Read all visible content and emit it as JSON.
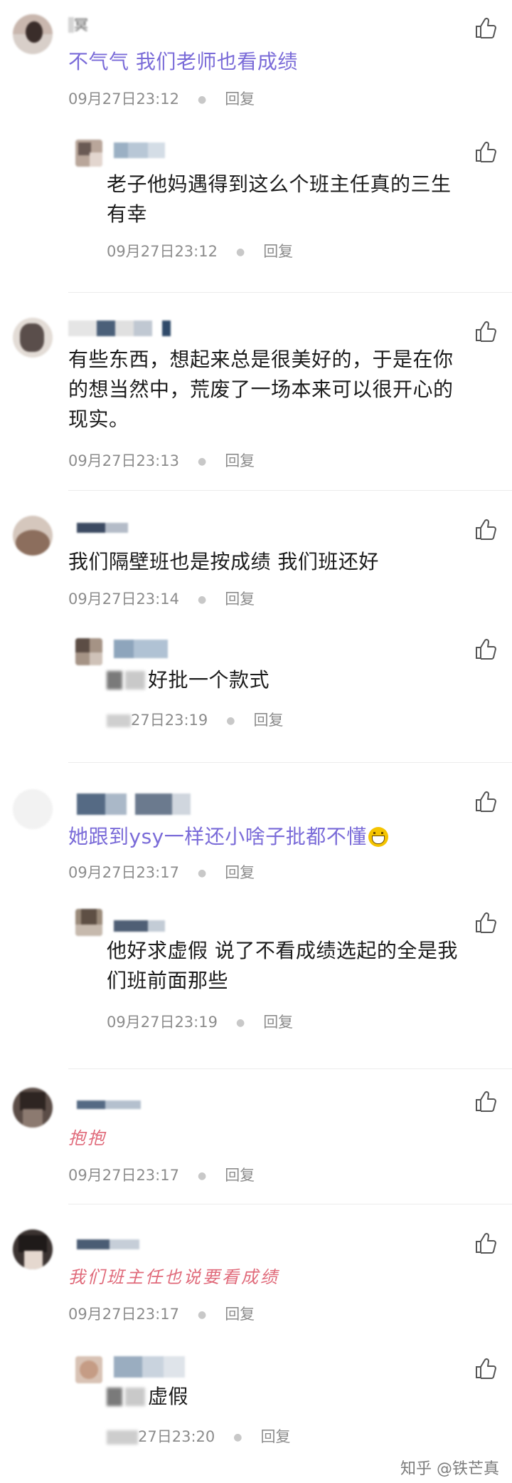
{
  "reply_label": "回复",
  "comments": [
    {
      "name_fragment": "冥",
      "text": "不气气 我们老师也看成绩",
      "time": "09月27日23:12"
    },
    {
      "text": "老子他妈遇得到这么个班主任真的三生有幸",
      "text_line1": "老子他妈遇得到这么个班主任真的三生",
      "text_line2": "有幸",
      "time": "09月27日23:12"
    },
    {
      "text_line1": "有些东西，想起来总是很美好的，于是在你",
      "text_line2": "的想当然中，荒废了一场本来可以很开心的",
      "text_line3": "现实。",
      "time": "09月27日23:13"
    },
    {
      "text": "我们隔壁班也是按成绩 我们班还好",
      "time": "09月27日23:14"
    },
    {
      "text": "好批一个款式",
      "time": "27日23:19"
    },
    {
      "text": "她跟到ysy一样还小啥子批都不懂",
      "time": "09月27日23:17"
    },
    {
      "text_line1": "他好求虚假 说了不看成绩选起的全是我",
      "text_line2": "们班前面那些",
      "time": "09月27日23:19"
    },
    {
      "text": "抱抱",
      "time": "09月27日23:17"
    },
    {
      "text": "我们班主任也说要看成绩",
      "time": "09月27日23:17"
    },
    {
      "text": "虚假",
      "time": "27日23:20"
    }
  ],
  "watermark": "知乎 @铁芒真",
  "icons": {
    "like": "thumbs-up-icon"
  },
  "colors": {
    "purple_text": "#7a6bd8",
    "script_text": "#e06a7a",
    "meta": "#8c8c8c"
  }
}
